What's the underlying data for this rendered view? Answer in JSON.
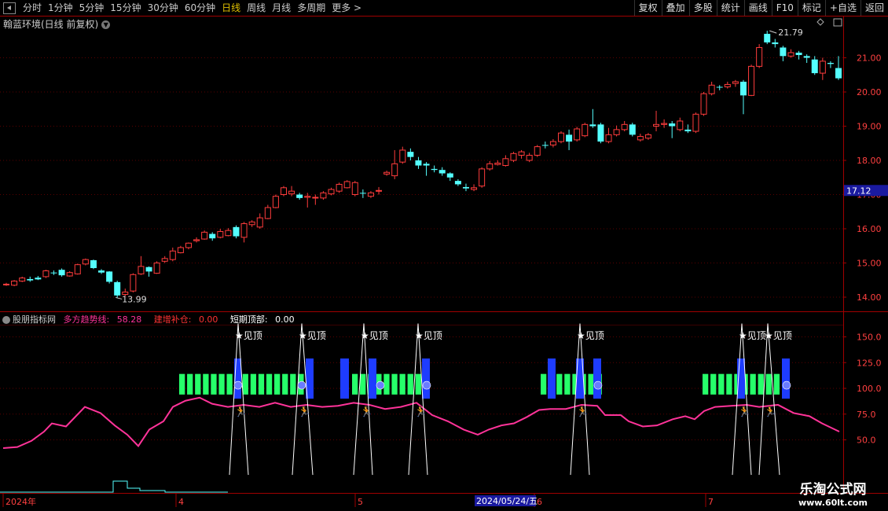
{
  "toolbar": {
    "periods": [
      "分时",
      "1分钟",
      "5分钟",
      "15分钟",
      "30分钟",
      "60分钟",
      "日线",
      "周线",
      "月线",
      "多周期",
      "更多 >"
    ],
    "active_period": "日线",
    "buttons": [
      "复权",
      "叠加",
      "多股",
      "统计",
      "画线",
      "F10",
      "标记",
      "+自选",
      "返回"
    ]
  },
  "main_chart": {
    "title": "翰蓝环境(日线 前复权)",
    "price_axis": [
      "21.00",
      "20.00",
      "19.00",
      "18.00",
      "17.00",
      "16.00",
      "15.00",
      "14.00"
    ],
    "current_price_tag": "17.12",
    "high_label": "21.79",
    "low_label": "13.99"
  },
  "indicator": {
    "name": "股朋指标网",
    "trend_label": "多方趋势线:",
    "trend_value": "58.28",
    "build_label": "建增补仓:",
    "build_value": "0.00",
    "top_label": "短期顶部:",
    "top_value": "0.00",
    "axis": [
      "150.0",
      "125.0",
      "100.0",
      "75.0",
      "50.0"
    ],
    "peak_label": "见顶"
  },
  "time_axis": {
    "labels": [
      "2024年",
      "4",
      "5",
      "6",
      "7"
    ],
    "cursor_date": "2024/05/24/五"
  },
  "watermark": {
    "title": "乐淘公式网",
    "url": "www.60lt.com"
  },
  "colors": {
    "up": "#ff3c3c",
    "down": "#54ffff",
    "trend": "#ff3399",
    "blue_bar": "#1e3cff",
    "green_bar": "#26ff6a",
    "grid": "#5a0000",
    "border": "#a00000"
  }
}
